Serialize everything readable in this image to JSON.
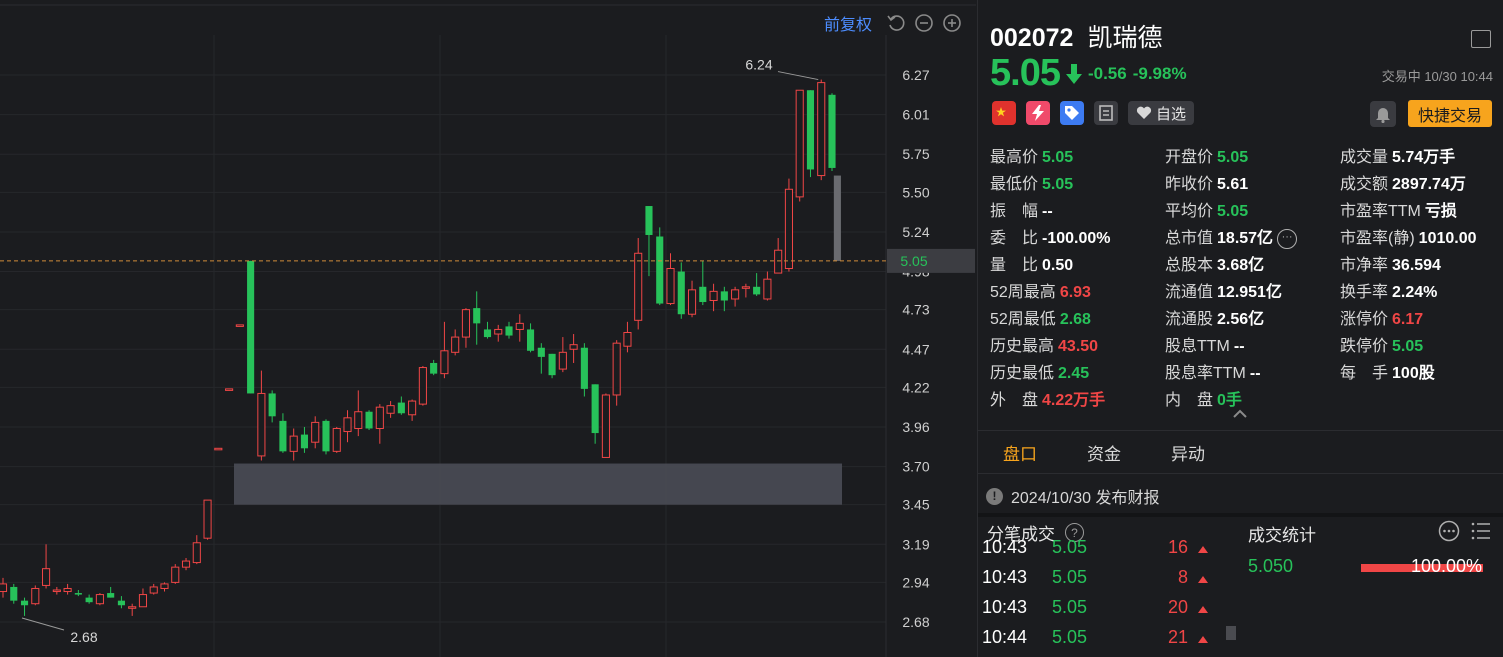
{
  "toolbar": {
    "adjust_label": "前复权",
    "icons": [
      "undo-icon",
      "zoom-out-icon",
      "zoom-in-icon"
    ]
  },
  "colors": {
    "up": "#f04646",
    "down": "#27c25a",
    "accent": "#f7a41d",
    "link": "#4d8dff"
  },
  "chart_data": {
    "type": "candlestick",
    "y_ticks": [
      "6.27",
      "6.01",
      "5.75",
      "5.50",
      "5.24",
      "4.98",
      "4.73",
      "4.47",
      "4.22",
      "3.96",
      "3.70",
      "3.45",
      "3.19",
      "2.94",
      "2.68"
    ],
    "current_price_label": "5.05",
    "high_annotation": "6.24",
    "low_annotation": "2.68",
    "ylim": [
      2.68,
      6.27
    ],
    "candles": [
      {
        "o": 2.88,
        "h": 2.97,
        "l": 2.84,
        "c": 2.93
      },
      {
        "o": 2.91,
        "h": 2.93,
        "l": 2.8,
        "c": 2.82
      },
      {
        "o": 2.82,
        "h": 2.84,
        "l": 2.72,
        "c": 2.79
      },
      {
        "o": 2.8,
        "h": 2.92,
        "l": 2.79,
        "c": 2.9
      },
      {
        "o": 2.92,
        "h": 3.19,
        "l": 2.9,
        "c": 3.03
      },
      {
        "o": 2.88,
        "h": 2.91,
        "l": 2.86,
        "c": 2.89
      },
      {
        "o": 2.88,
        "h": 2.93,
        "l": 2.86,
        "c": 2.9
      },
      {
        "o": 2.87,
        "h": 2.89,
        "l": 2.85,
        "c": 2.86
      },
      {
        "o": 2.84,
        "h": 2.86,
        "l": 2.8,
        "c": 2.81
      },
      {
        "o": 2.8,
        "h": 2.87,
        "l": 2.79,
        "c": 2.86
      },
      {
        "o": 2.87,
        "h": 2.91,
        "l": 2.84,
        "c": 2.84
      },
      {
        "o": 2.82,
        "h": 2.85,
        "l": 2.77,
        "c": 2.79
      },
      {
        "o": 2.77,
        "h": 2.8,
        "l": 2.72,
        "c": 2.78
      },
      {
        "o": 2.78,
        "h": 2.9,
        "l": 2.78,
        "c": 2.86
      },
      {
        "o": 2.87,
        "h": 2.93,
        "l": 2.86,
        "c": 2.91
      },
      {
        "o": 2.9,
        "h": 2.94,
        "l": 2.88,
        "c": 2.93
      },
      {
        "o": 2.94,
        "h": 3.06,
        "l": 2.93,
        "c": 3.04
      },
      {
        "o": 3.04,
        "h": 3.1,
        "l": 3.02,
        "c": 3.08
      },
      {
        "o": 3.07,
        "h": 3.25,
        "l": 3.06,
        "c": 3.2
      },
      {
        "o": 3.23,
        "h": 3.48,
        "l": 3.22,
        "c": 3.48
      },
      {
        "o": 3.81,
        "h": 3.82,
        "l": 3.81,
        "c": 3.82
      },
      {
        "o": 4.2,
        "h": 4.21,
        "l": 4.2,
        "c": 4.21
      },
      {
        "o": 4.62,
        "h": 4.63,
        "l": 4.62,
        "c": 4.63
      },
      {
        "o": 5.05,
        "h": 5.05,
        "l": 4.18,
        "c": 4.18
      },
      {
        "o": 3.77,
        "h": 4.33,
        "l": 3.74,
        "c": 4.18
      },
      {
        "o": 4.18,
        "h": 4.2,
        "l": 3.99,
        "c": 4.03
      },
      {
        "o": 4.0,
        "h": 4.05,
        "l": 3.79,
        "c": 3.8
      },
      {
        "o": 3.8,
        "h": 3.95,
        "l": 3.74,
        "c": 3.9
      },
      {
        "o": 3.91,
        "h": 3.96,
        "l": 3.79,
        "c": 3.82
      },
      {
        "o": 3.86,
        "h": 4.03,
        "l": 3.82,
        "c": 3.99
      },
      {
        "o": 4.0,
        "h": 4.01,
        "l": 3.78,
        "c": 3.8
      },
      {
        "o": 3.8,
        "h": 3.96,
        "l": 3.79,
        "c": 3.95
      },
      {
        "o": 3.93,
        "h": 4.07,
        "l": 3.86,
        "c": 4.02
      },
      {
        "o": 3.95,
        "h": 4.2,
        "l": 3.9,
        "c": 4.06
      },
      {
        "o": 4.06,
        "h": 4.07,
        "l": 3.94,
        "c": 3.95
      },
      {
        "o": 3.95,
        "h": 4.11,
        "l": 3.85,
        "c": 4.09
      },
      {
        "o": 4.05,
        "h": 4.13,
        "l": 4.02,
        "c": 4.1
      },
      {
        "o": 4.12,
        "h": 4.16,
        "l": 4.04,
        "c": 4.05
      },
      {
        "o": 4.04,
        "h": 4.14,
        "l": 4.0,
        "c": 4.13
      },
      {
        "o": 4.11,
        "h": 4.36,
        "l": 4.1,
        "c": 4.35
      },
      {
        "o": 4.38,
        "h": 4.4,
        "l": 4.3,
        "c": 4.31
      },
      {
        "o": 4.31,
        "h": 4.65,
        "l": 4.28,
        "c": 4.46
      },
      {
        "o": 4.45,
        "h": 4.6,
        "l": 4.43,
        "c": 4.55
      },
      {
        "o": 4.55,
        "h": 4.74,
        "l": 4.48,
        "c": 4.73
      },
      {
        "o": 4.74,
        "h": 4.85,
        "l": 4.5,
        "c": 4.64
      },
      {
        "o": 4.6,
        "h": 4.65,
        "l": 4.54,
        "c": 4.55
      },
      {
        "o": 4.57,
        "h": 4.63,
        "l": 4.52,
        "c": 4.6
      },
      {
        "o": 4.62,
        "h": 4.65,
        "l": 4.54,
        "c": 4.56
      },
      {
        "o": 4.6,
        "h": 4.7,
        "l": 4.52,
        "c": 4.64
      },
      {
        "o": 4.6,
        "h": 4.64,
        "l": 4.45,
        "c": 4.46
      },
      {
        "o": 4.48,
        "h": 4.51,
        "l": 4.31,
        "c": 4.42
      },
      {
        "o": 4.44,
        "h": 4.44,
        "l": 4.28,
        "c": 4.3
      },
      {
        "o": 4.34,
        "h": 4.55,
        "l": 4.32,
        "c": 4.45
      },
      {
        "o": 4.47,
        "h": 4.57,
        "l": 4.38,
        "c": 4.5
      },
      {
        "o": 4.48,
        "h": 4.51,
        "l": 4.16,
        "c": 4.21
      },
      {
        "o": 4.24,
        "h": 4.24,
        "l": 3.85,
        "c": 3.92
      },
      {
        "o": 3.76,
        "h": 4.18,
        "l": 3.76,
        "c": 4.17
      },
      {
        "o": 4.17,
        "h": 4.53,
        "l": 4.1,
        "c": 4.51
      },
      {
        "o": 4.49,
        "h": 4.65,
        "l": 4.45,
        "c": 4.58
      },
      {
        "o": 4.66,
        "h": 5.2,
        "l": 4.6,
        "c": 5.1
      },
      {
        "o": 5.41,
        "h": 5.41,
        "l": 4.95,
        "c": 5.22
      },
      {
        "o": 5.21,
        "h": 5.27,
        "l": 4.76,
        "c": 4.77
      },
      {
        "o": 4.77,
        "h": 5.1,
        "l": 4.76,
        "c": 5.0
      },
      {
        "o": 4.98,
        "h": 5.04,
        "l": 4.67,
        "c": 4.7
      },
      {
        "o": 4.7,
        "h": 4.92,
        "l": 4.68,
        "c": 4.86
      },
      {
        "o": 4.88,
        "h": 5.05,
        "l": 4.76,
        "c": 4.78
      },
      {
        "o": 4.79,
        "h": 4.9,
        "l": 4.72,
        "c": 4.85
      },
      {
        "o": 4.85,
        "h": 4.88,
        "l": 4.72,
        "c": 4.79
      },
      {
        "o": 4.8,
        "h": 4.88,
        "l": 4.75,
        "c": 4.86
      },
      {
        "o": 4.87,
        "h": 4.9,
        "l": 4.81,
        "c": 4.88
      },
      {
        "o": 4.88,
        "h": 4.97,
        "l": 4.82,
        "c": 4.83
      },
      {
        "o": 4.8,
        "h": 4.98,
        "l": 4.79,
        "c": 4.93
      },
      {
        "o": 4.97,
        "h": 5.2,
        "l": 4.97,
        "c": 5.12
      },
      {
        "o": 5.0,
        "h": 5.59,
        "l": 4.98,
        "c": 5.52
      },
      {
        "o": 5.47,
        "h": 6.17,
        "l": 5.44,
        "c": 6.17
      },
      {
        "o": 6.17,
        "h": 6.17,
        "l": 5.6,
        "c": 5.65
      },
      {
        "o": 5.61,
        "h": 6.24,
        "l": 5.58,
        "c": 6.22
      },
      {
        "o": 6.14,
        "h": 6.15,
        "l": 5.64,
        "c": 5.66
      }
    ]
  },
  "quote": {
    "code": "002072",
    "name": "凯瑞德",
    "price": "5.05",
    "change": "-0.56",
    "change_pct": "-9.98%",
    "status": "交易中 10/30 10:44",
    "watch_label": "自选",
    "quick_trade_label": "快捷交易",
    "tag_icons": [
      "china-flag-icon",
      "lightning-icon",
      "tag-icon",
      "document-icon"
    ],
    "fields": [
      {
        "label": "最高价",
        "value": "5.05",
        "color": "g"
      },
      {
        "label": "开盘价",
        "value": "5.05",
        "color": "g"
      },
      {
        "label": "成交量",
        "value": "5.74万手",
        "color": "w"
      },
      {
        "label": "最低价",
        "value": "5.05",
        "color": "g"
      },
      {
        "label": "昨收价",
        "value": "5.61",
        "color": "w"
      },
      {
        "label": "成交额",
        "value": "2897.74万",
        "color": "w"
      },
      {
        "label": "振　幅",
        "value": "--",
        "color": "w"
      },
      {
        "label": "平均价",
        "value": "5.05",
        "color": "g"
      },
      {
        "label": "市盈率TTM",
        "value": "亏损",
        "color": "w"
      },
      {
        "label": "委　比",
        "value": "-100.00%",
        "color": "w"
      },
      {
        "label": "总市值",
        "value": "18.57亿",
        "color": "w"
      },
      {
        "label": "市盈率(静)",
        "value": "1010.00",
        "color": "w"
      },
      {
        "label": "量　比",
        "value": "0.50",
        "color": "w"
      },
      {
        "label": "总股本",
        "value": "3.68亿",
        "color": "w"
      },
      {
        "label": "市净率",
        "value": "36.594",
        "color": "w"
      },
      {
        "label": "52周最高",
        "value": "6.93",
        "color": "r"
      },
      {
        "label": "流通值",
        "value": "12.951亿",
        "color": "w"
      },
      {
        "label": "换手率",
        "value": "2.24%",
        "color": "w"
      },
      {
        "label": "52周最低",
        "value": "2.68",
        "color": "g"
      },
      {
        "label": "流通股",
        "value": "2.56亿",
        "color": "w"
      },
      {
        "label": "涨停价",
        "value": "6.17",
        "color": "r"
      },
      {
        "label": "历史最高",
        "value": "43.50",
        "color": "r"
      },
      {
        "label": "股息TTM",
        "value": "--",
        "color": "w"
      },
      {
        "label": "跌停价",
        "value": "5.05",
        "color": "g"
      },
      {
        "label": "历史最低",
        "value": "2.45",
        "color": "g"
      },
      {
        "label": "股息率TTM",
        "value": "--",
        "color": "w"
      },
      {
        "label": "每　手",
        "value": "100股",
        "color": "w"
      },
      {
        "label": "外　盘",
        "value": "4.22万手",
        "color": "r"
      },
      {
        "label": "内　盘",
        "value": "0手",
        "color": "g"
      }
    ]
  },
  "tabs": [
    "盘口",
    "资金",
    "异动"
  ],
  "notice": "2024/10/30  发布财报",
  "trades": {
    "title": "分笔成交",
    "rows": [
      {
        "time": "10:43",
        "price": "5.05",
        "vol": "16"
      },
      {
        "time": "10:43",
        "price": "5.05",
        "vol": "8"
      },
      {
        "time": "10:43",
        "price": "5.05",
        "vol": "20"
      },
      {
        "time": "10:44",
        "price": "5.05",
        "vol": "21"
      }
    ]
  },
  "stats": {
    "title": "成交统计",
    "rows": [
      {
        "price": "5.050",
        "pct": "100.00%",
        "share": 1.0
      }
    ]
  }
}
